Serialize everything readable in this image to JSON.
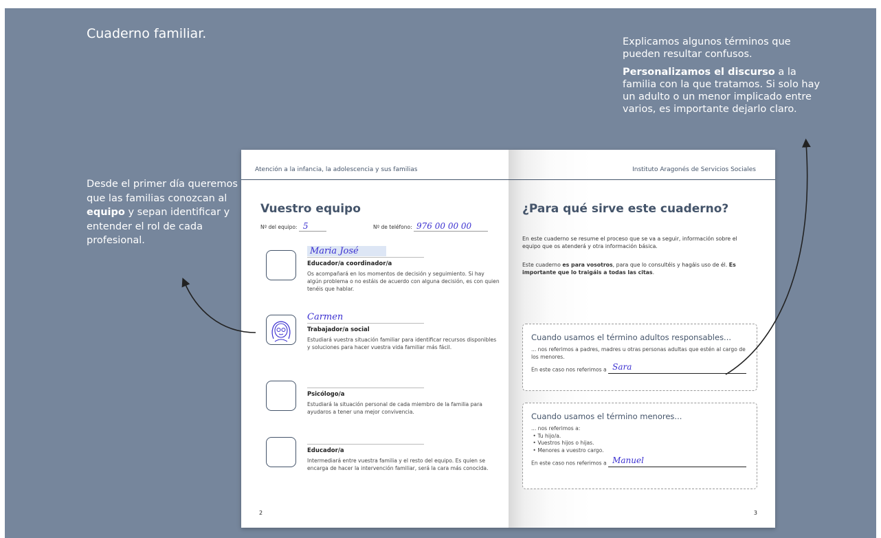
{
  "title": "Cuaderno familiar.",
  "note_left": {
    "before": "Desde el primer día queremos que las familias conozcan al ",
    "bold": "equipo",
    "after": " y sepan identificar y entender el rol de cada profesional."
  },
  "note_right": {
    "p1": "Explicamos algunos términos que pueden resultar confusos.",
    "bold": "Personalizamos el discurso",
    "rest": " a la familia con la que tratamos. Si solo hay un adulto o un menor implicado entre varios, es importante dejarlo claro."
  },
  "left_page": {
    "header": "Atención a la infancia, la adolescencia y sus familias",
    "heading": "Vuestro equipo",
    "team_label": "Nº del equipo:",
    "team_value": "5",
    "phone_label": "Nº de teléfono:",
    "phone_value": "976 00 00 00",
    "page_number": "2",
    "roles": [
      {
        "name": "Maria José",
        "title": "Educador/a coordinador/a",
        "desc": "Os acompañará en los momentos de decisión y seguimiento. Si hay algún problema o no estáis de acuerdo con alguna decisión, es con quien tenéis que hablar."
      },
      {
        "name": "Carmen",
        "title": "Trabajador/a social",
        "desc": "Estudiará vuestra situación familiar para identificar recursos disponibles y soluciones para hacer vuestra vida familiar más fácil."
      },
      {
        "name": "",
        "title": "Psicólogo/a",
        "desc": "Estudiará la situación personal de cada miembro de la familia para ayudaros a tener una mejor convivencia."
      },
      {
        "name": "",
        "title": "Educador/a",
        "desc": "Intermediará entre vuestra familia y el resto del equipo. Es quien se encarga de hacer la intervención familiar, será la cara más conocida."
      }
    ]
  },
  "right_page": {
    "header": "Instituto Aragonés de Servicios Sociales",
    "heading": "¿Para qué sirve este cuaderno?",
    "p1": "En este cuaderno se resume el proceso que se va a seguir, información sobre el equipo que os atenderá y otra información básica.",
    "p2_a": "Este cuaderno ",
    "p2_b": "es para vosotros",
    "p2_c": ", para que lo consultéis y hagáis uso de él. ",
    "p2_d": "Es importante que lo traigáis a todas las citas",
    "p2_e": ".",
    "card1": {
      "title": "Cuando usamos el término adultos responsables...",
      "desc": "... nos referimos a padres, madres u otras personas adultas que estén al cargo de los menores.",
      "fill_label": "En este caso nos referimos a",
      "fill_value": "Sara"
    },
    "card2": {
      "title": "Cuando usamos el término menores...",
      "lead": "... nos referimos a:",
      "items": [
        "Tu hijo/a.",
        "Vuestros hijos o hijas.",
        "Menores a vuestro cargo."
      ],
      "fill_label": "En este caso nos referimos a",
      "fill_value": "Manuel"
    },
    "page_number": "3"
  }
}
